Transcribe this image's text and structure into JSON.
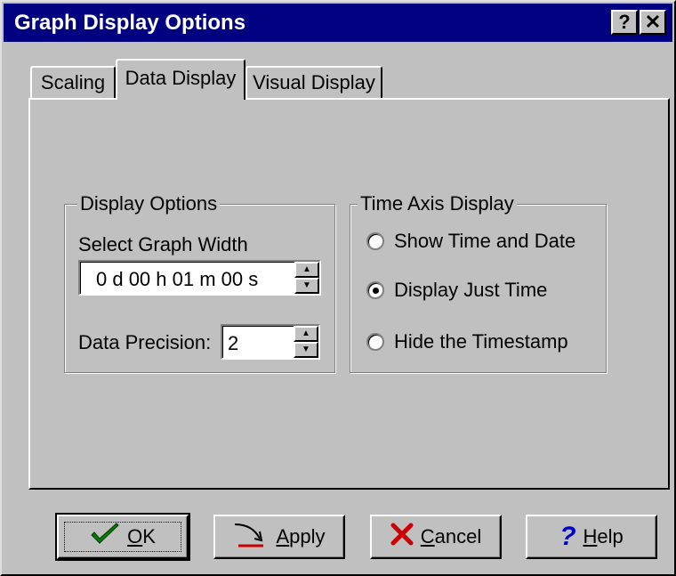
{
  "window": {
    "title": "Graph Display Options",
    "help_button": "?",
    "close_button": "✕"
  },
  "tabs": [
    {
      "label": "Scaling",
      "active": false
    },
    {
      "label": "Data Display",
      "active": true
    },
    {
      "label": "Visual Display",
      "active": false
    }
  ],
  "display_options": {
    "group_title": "Display Options",
    "graph_width_label": "Select Graph Width",
    "graph_width_value": "0 d 00 h 01 m 00 s",
    "precision_label": "Data Precision:",
    "precision_value": "2"
  },
  "time_axis": {
    "group_title": "Time Axis Display",
    "options": [
      {
        "label": "Show Time and Date",
        "selected": false
      },
      {
        "label": "Display Just Time",
        "selected": true
      },
      {
        "label": "Hide the Timestamp",
        "selected": false
      }
    ]
  },
  "buttons": {
    "ok": {
      "label": "OK",
      "mnemonic": "O",
      "rest": "K",
      "icon": "checkmark-icon"
    },
    "apply": {
      "label": "Apply",
      "mnemonic": "A",
      "rest": "pply",
      "icon": "apply-arrow-icon"
    },
    "cancel": {
      "label": "Cancel",
      "mnemonic": "C",
      "rest": "ancel",
      "icon": "red-x-icon"
    },
    "help": {
      "label": "Help",
      "mnemonic": "H",
      "rest": "elp",
      "icon": "question-mark-icon"
    }
  },
  "colors": {
    "titlebar": "#000080",
    "face": "#c0c0c0",
    "ok_check": "#008000",
    "cancel_x": "#cc0000",
    "help_q": "#0000cc"
  }
}
